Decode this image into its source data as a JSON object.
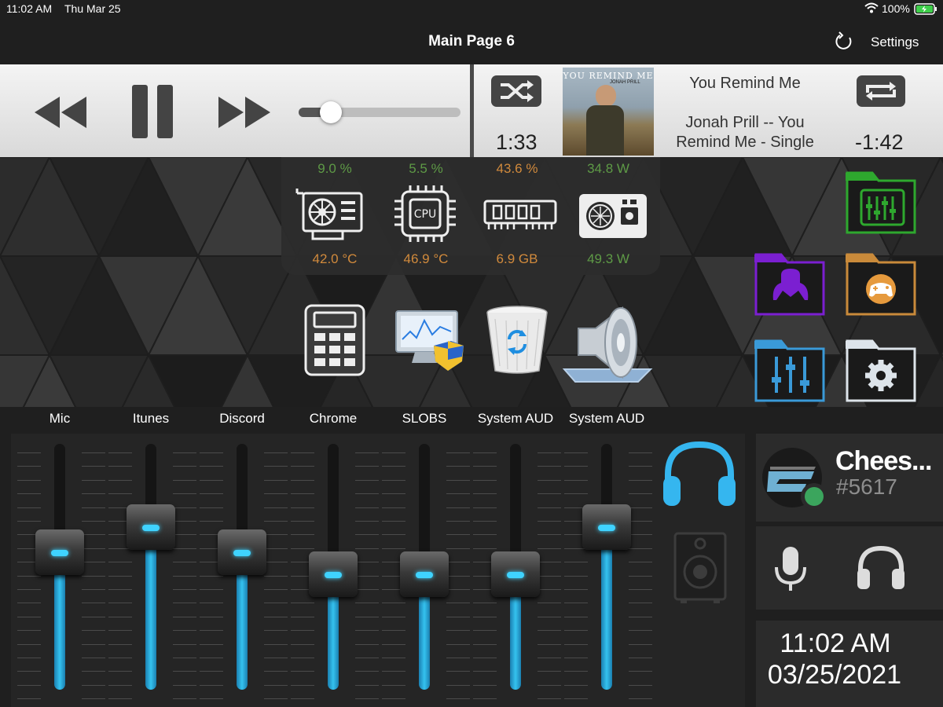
{
  "status_bar": {
    "time": "11:02 AM",
    "date": "Thu Mar 25",
    "battery": "100%"
  },
  "header": {
    "title": "Main Page 6",
    "settings_label": "Settings"
  },
  "player": {
    "elapsed": "1:33",
    "remaining": "-1:42",
    "song_title": "You Remind Me",
    "artist_line1": "Jonah Prill -- You",
    "artist_line2": "Remind Me - Single",
    "album_art_title": "YOU REMIND ME",
    "album_art_artist": "JONAH PRILL",
    "volume_fraction": 0.2
  },
  "stats": [
    {
      "name": "gpu",
      "top": "9.0 %",
      "bottom": "42.0 °C"
    },
    {
      "name": "cpu",
      "top": "5.5 %",
      "bottom": "46.9 °C",
      "chip_label": "CPU"
    },
    {
      "name": "ram",
      "top": "43.6 %",
      "bottom": "6.9 GB"
    },
    {
      "name": "psu",
      "top": "34.8 W",
      "bottom": "49.3 W"
    }
  ],
  "mixer": {
    "channels": [
      {
        "label": "Mic",
        "level": 0.56
      },
      {
        "label": "Itunes",
        "level": 0.66
      },
      {
        "label": "Discord",
        "level": 0.56
      },
      {
        "label": "Chrome",
        "level": 0.47
      },
      {
        "label": "SLOBS",
        "level": 0.47
      },
      {
        "label": "System AUD",
        "level": 0.47
      },
      {
        "label": "System AUD",
        "level": 0.66
      }
    ]
  },
  "discord": {
    "username": "Chees...",
    "tag": "#5617"
  },
  "clock": {
    "time": "11:02 AM",
    "date": "03/25/2021"
  },
  "colors": {
    "accent": "#35c2ef",
    "stat_green": "#5e9a46",
    "stat_orange": "#d18a3c",
    "folder_green": "#2ea82e",
    "folder_purple": "#7b1fd1",
    "folder_orange": "#c98a3a",
    "folder_blue": "#3a9ad8"
  }
}
